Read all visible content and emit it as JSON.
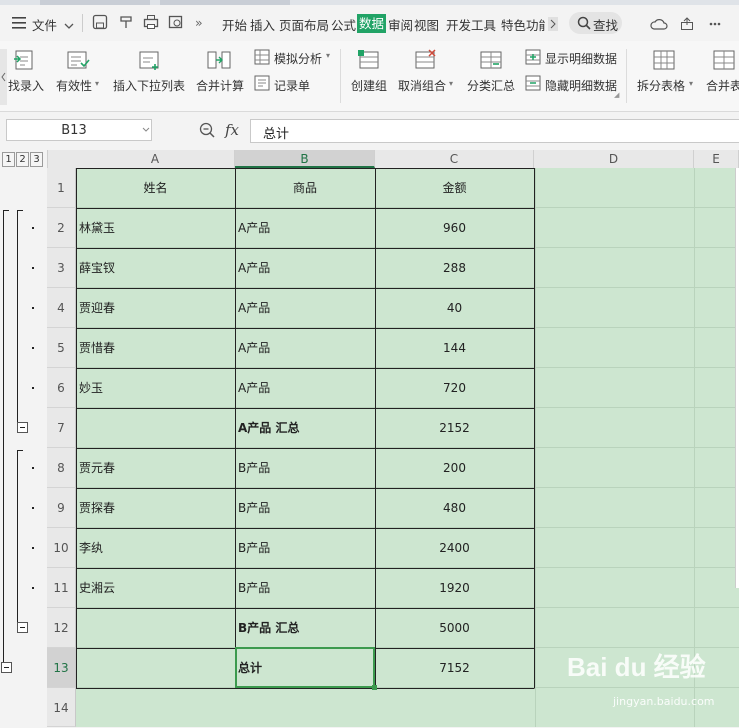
{
  "menubar": {
    "file": "文件",
    "tabs": [
      "开始",
      "插入",
      "页面布局",
      "公式",
      "数据",
      "审阅",
      "视图",
      "开发工具",
      "特色功能"
    ],
    "active_tab": "数据",
    "search": "查找",
    "accent": "#21a366"
  },
  "ribbon": {
    "items": {
      "import": "找录入",
      "validity": "有效性",
      "dropdown": "插入下拉列表",
      "consolidate": "合并计算",
      "simulate": "模拟分析",
      "record": "记录单",
      "group": "创建组",
      "ungroup": "取消组合",
      "subtotal": "分类汇总",
      "show_detail": "显示明细数据",
      "hide_detail": "隐藏明细数据",
      "split_table": "拆分表格",
      "merge_table": "合并表"
    }
  },
  "formula_bar": {
    "name_box": "B13",
    "fx": "fx",
    "value": "总计"
  },
  "sheet": {
    "outline_levels": [
      "1",
      "2",
      "3"
    ],
    "columns": [
      "A",
      "B",
      "C",
      "D",
      "E"
    ],
    "selected_column": "B",
    "selected_row": "13",
    "rows": [
      {
        "num": "1",
        "a": "姓名",
        "b": "商品",
        "c": "金额",
        "header": true
      },
      {
        "num": "2",
        "a": "林黛玉",
        "b": "A产品",
        "c": "960"
      },
      {
        "num": "3",
        "a": "薛宝钗",
        "b": "A产品",
        "c": "288"
      },
      {
        "num": "4",
        "a": "贾迎春",
        "b": "A产品",
        "c": "40"
      },
      {
        "num": "5",
        "a": "贾惜春",
        "b": "A产品",
        "c": "144"
      },
      {
        "num": "6",
        "a": "妙玉",
        "b": "A产品",
        "c": "720"
      },
      {
        "num": "7",
        "a": "",
        "b": "A产品 汇总",
        "c": "2152",
        "bold": true
      },
      {
        "num": "8",
        "a": "贾元春",
        "b": "B产品",
        "c": "200"
      },
      {
        "num": "9",
        "a": "贾探春",
        "b": "B产品",
        "c": "480"
      },
      {
        "num": "10",
        "a": "李纨",
        "b": "B产品",
        "c": "2400"
      },
      {
        "num": "11",
        "a": "史湘云",
        "b": "B产品",
        "c": "1920"
      },
      {
        "num": "12",
        "a": "",
        "b": "B产品 汇总",
        "c": "5000",
        "bold": true
      },
      {
        "num": "13",
        "a": "",
        "b": "总计",
        "c": "7152",
        "bold": true
      },
      {
        "num": "14",
        "a": "",
        "b": "",
        "c": ""
      }
    ],
    "cell_fill": "#cde6d0",
    "selection_color": "#217346"
  },
  "watermark": {
    "brand": "Bai du 经验",
    "url": "jingyan.baidu.com"
  }
}
